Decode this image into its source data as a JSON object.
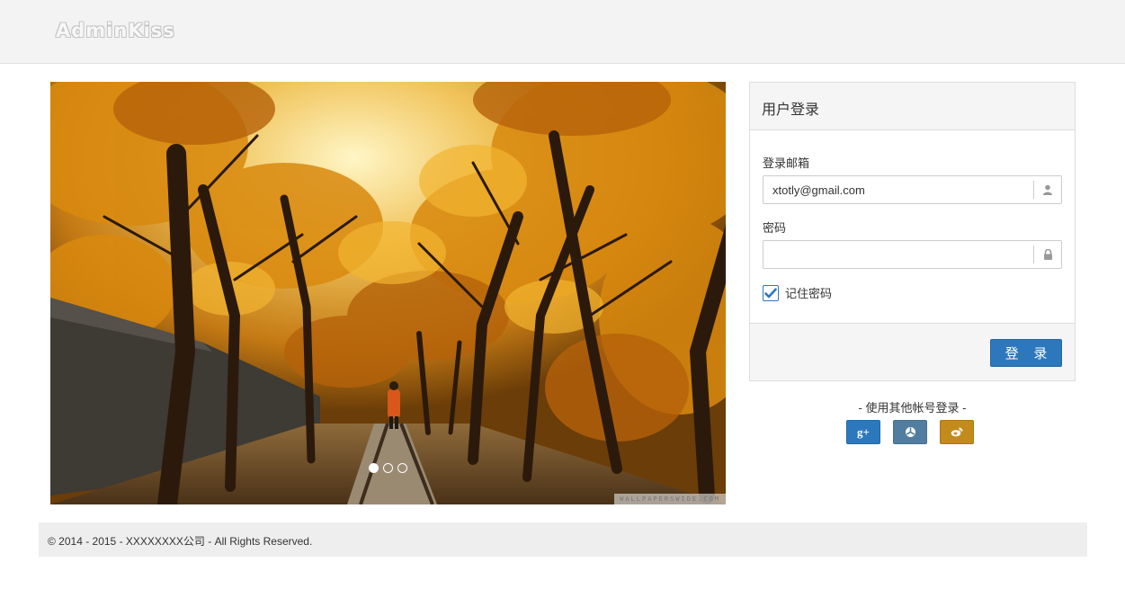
{
  "header": {
    "logo_text": "AdminKiss"
  },
  "carousel": {
    "slide_count": 3,
    "active_index": 0,
    "watermark": "WALLPAPERSWIDE.COM"
  },
  "login": {
    "title": "用户登录",
    "email_label": "登录邮箱",
    "email_value": "xtotly@gmail.com",
    "email_icon": "user-icon",
    "password_label": "密码",
    "password_value": "",
    "password_icon": "lock-icon",
    "remember_label": "记住密码",
    "remember_checked": true,
    "submit_label": "登 录"
  },
  "other_login": {
    "label": "- 使用其他帐号登录 -",
    "providers": [
      {
        "name": "google-plus",
        "glyph": "g+",
        "color": "#2d78bd"
      },
      {
        "name": "aperture",
        "glyph": "",
        "color": "#517ea0"
      },
      {
        "name": "weibo",
        "glyph": "",
        "color": "#c38b1b"
      }
    ]
  },
  "footer": {
    "copyright": "© 2014 - 2015 - XXXXXXXX公司 - All Rights Reserved."
  },
  "colors": {
    "primary": "#2d78bd",
    "topbar_bg": "#f3f3f3",
    "footer_bg": "#eeeeee"
  }
}
